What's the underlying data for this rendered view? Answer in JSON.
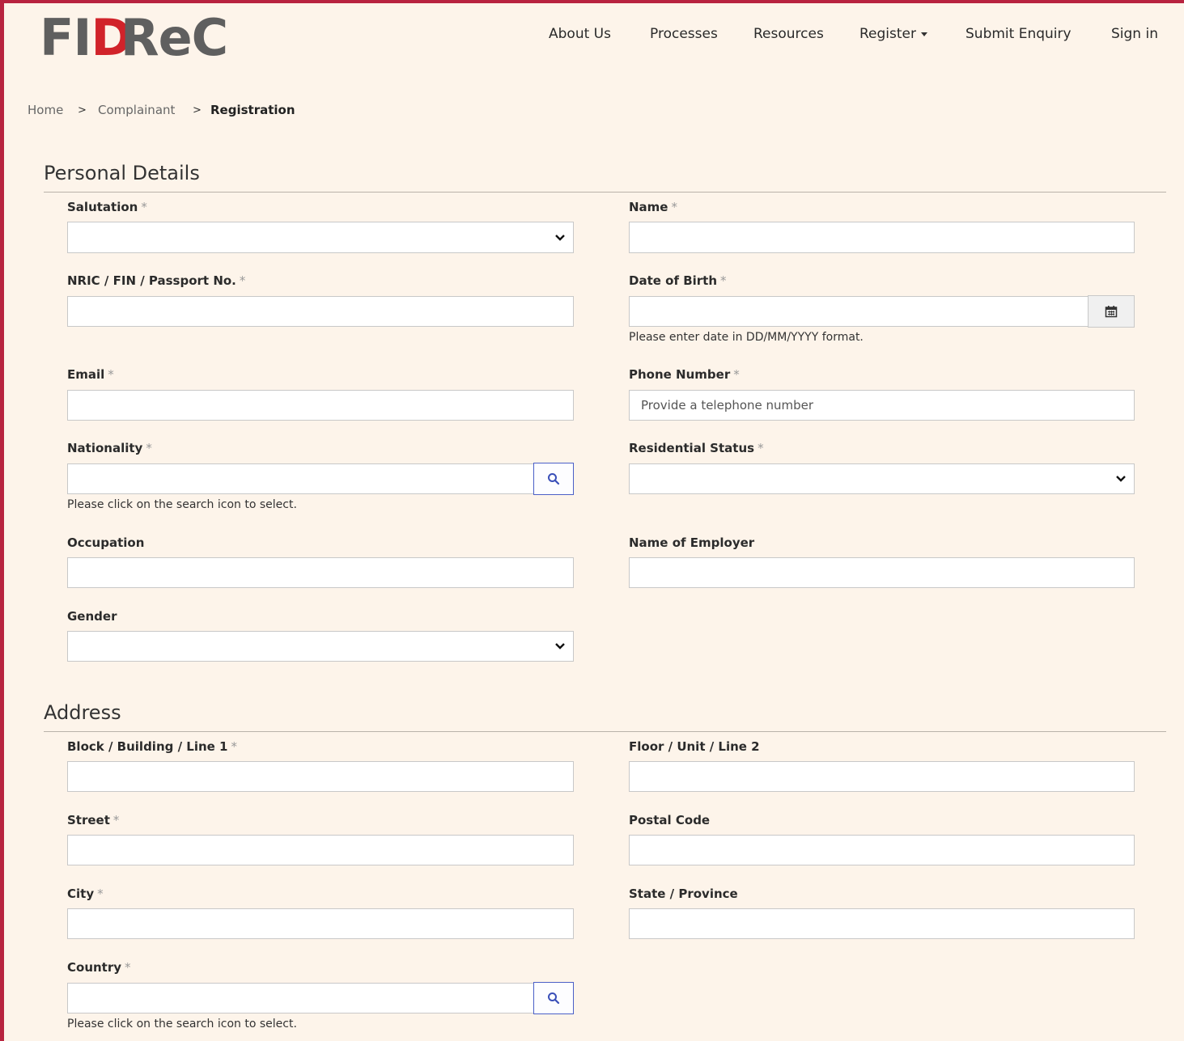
{
  "brand": {
    "logo_part1": "FI",
    "logo_part2": "D",
    "logo_part3": "ReC",
    "accent_color": "#b8233f",
    "logo_red": "#d1232a"
  },
  "nav": {
    "about": "About Us",
    "processes": "Processes",
    "resources": "Resources",
    "register": "Register",
    "submit_enquiry": "Submit Enquiry",
    "sign_in": "Sign in"
  },
  "breadcrumb": {
    "home": "Home",
    "complainant": "Complainant",
    "current": "Registration",
    "separator": ">"
  },
  "required_mark": "*",
  "personal": {
    "title": "Personal Details",
    "salutation": {
      "label": "Salutation",
      "value": ""
    },
    "name": {
      "label": "Name",
      "value": ""
    },
    "nric": {
      "label": "NRIC / FIN / Passport No.",
      "value": ""
    },
    "dob": {
      "label": "Date of Birth",
      "value": "",
      "help": "Please enter date in DD/MM/YYYY format."
    },
    "email": {
      "label": "Email",
      "value": ""
    },
    "phone": {
      "label": "Phone Number",
      "value": "",
      "placeholder": "Provide a telephone number"
    },
    "nationality": {
      "label": "Nationality",
      "value": "",
      "help": "Please click on the search icon to select."
    },
    "residential_status": {
      "label": "Residential Status",
      "value": ""
    },
    "occupation": {
      "label": "Occupation",
      "value": ""
    },
    "employer": {
      "label": "Name of Employer",
      "value": ""
    },
    "gender": {
      "label": "Gender",
      "value": ""
    }
  },
  "address": {
    "title": "Address",
    "line1": {
      "label": "Block / Building / Line 1",
      "value": ""
    },
    "line2": {
      "label": "Floor / Unit / Line 2",
      "value": ""
    },
    "street": {
      "label": "Street",
      "value": ""
    },
    "postal": {
      "label": "Postal Code",
      "value": ""
    },
    "city": {
      "label": "City",
      "value": ""
    },
    "state": {
      "label": "State / Province",
      "value": ""
    },
    "country": {
      "label": "Country",
      "value": "",
      "help": "Please click on the search icon to select."
    }
  },
  "icons": {
    "search": "search-icon",
    "calendar": "calendar-icon",
    "dropdown": "chevron-down-icon"
  }
}
